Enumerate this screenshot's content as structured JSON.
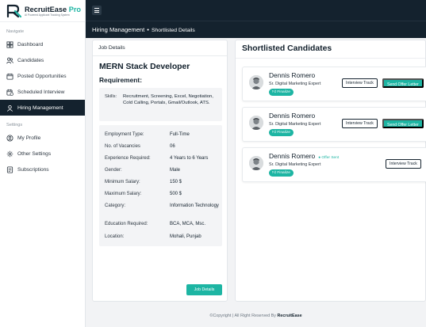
{
  "brand": {
    "name_main": "RecruitEase",
    "name_accent": "Pro",
    "tagline": "AI Powered Applicant Tracking System"
  },
  "colors": {
    "dark": "#14222e",
    "accent": "#1db5a3"
  },
  "sidebar": {
    "navigate_heading": "Navigate",
    "nav_items": [
      {
        "label": "Dashboard",
        "icon": "dashboard-icon"
      },
      {
        "label": "Candidates",
        "icon": "users-icon"
      },
      {
        "label": "Posted Opportunities",
        "icon": "calendar-icon"
      },
      {
        "label": "Scheduled Interview",
        "icon": "calendar-clock-icon"
      },
      {
        "label": "Hiring Management",
        "icon": "hiring-icon",
        "active": true
      }
    ],
    "settings_heading": "Settings",
    "settings_items": [
      {
        "label": "My Profile",
        "icon": "profile-icon"
      },
      {
        "label": "Other Settings",
        "icon": "gear-icon"
      },
      {
        "label": "Subscriptions",
        "icon": "subscription-icon"
      }
    ]
  },
  "header": {
    "breadcrumb_parent": "Hiring Management",
    "breadcrumb_separator": "•",
    "breadcrumb_current": "Shortlisted Details"
  },
  "job": {
    "panel_title": "Job Details",
    "title": "MERN Stack Developer",
    "requirement_label": "Requirement:",
    "skills_label": "Skills:",
    "skills_value": "Recruitment, Screening, Excel, Negotiation, Cold Calling, Portals, Gmail/Outlook, ATS.",
    "details": [
      {
        "key": "Employment Type:",
        "value": "Full-Time"
      },
      {
        "key": "No. of Vacancies",
        "value": "06"
      },
      {
        "key": "Experience Required:",
        "value": "4 Years to 6 Years"
      },
      {
        "key": "Gender:",
        "value": "Male"
      },
      {
        "key": "Minimum Salary:",
        "value": "150 $"
      },
      {
        "key": "Maximum Salary:",
        "value": "500 $"
      },
      {
        "key": "Category:",
        "value": "Information Technology"
      },
      {
        "key": "Education Required:",
        "value": "BCA, MCA, Msc."
      },
      {
        "key": "Location:",
        "value": "Mohali, Punjab"
      }
    ],
    "details_button": "Job Details"
  },
  "shortlisted": {
    "title": "Shortlisted Candidates",
    "candidates": [
      {
        "name": "Dennis Romero",
        "role": "Sr. Digital Marketing Expert",
        "finalize_label": "Finalize",
        "interview_label": "Interview Track",
        "offer_label": "Send Offer Letter",
        "badge": ""
      },
      {
        "name": "Dennis Romero",
        "role": "Sr. Digital Marketing Expert",
        "finalize_label": "Finalize",
        "interview_label": "Interview Track",
        "offer_label": "Send Offer Letter",
        "badge": ""
      },
      {
        "name": "Dennis Romero",
        "role": "Sr. Digital Marketing Expert",
        "finalize_label": "Finalize",
        "interview_label": "Interview Track",
        "offer_label": "",
        "badge": "Offer Sent"
      }
    ]
  },
  "footer": {
    "text": "©Copyright | All Right Reserved By",
    "brand": "RecruitEase"
  }
}
